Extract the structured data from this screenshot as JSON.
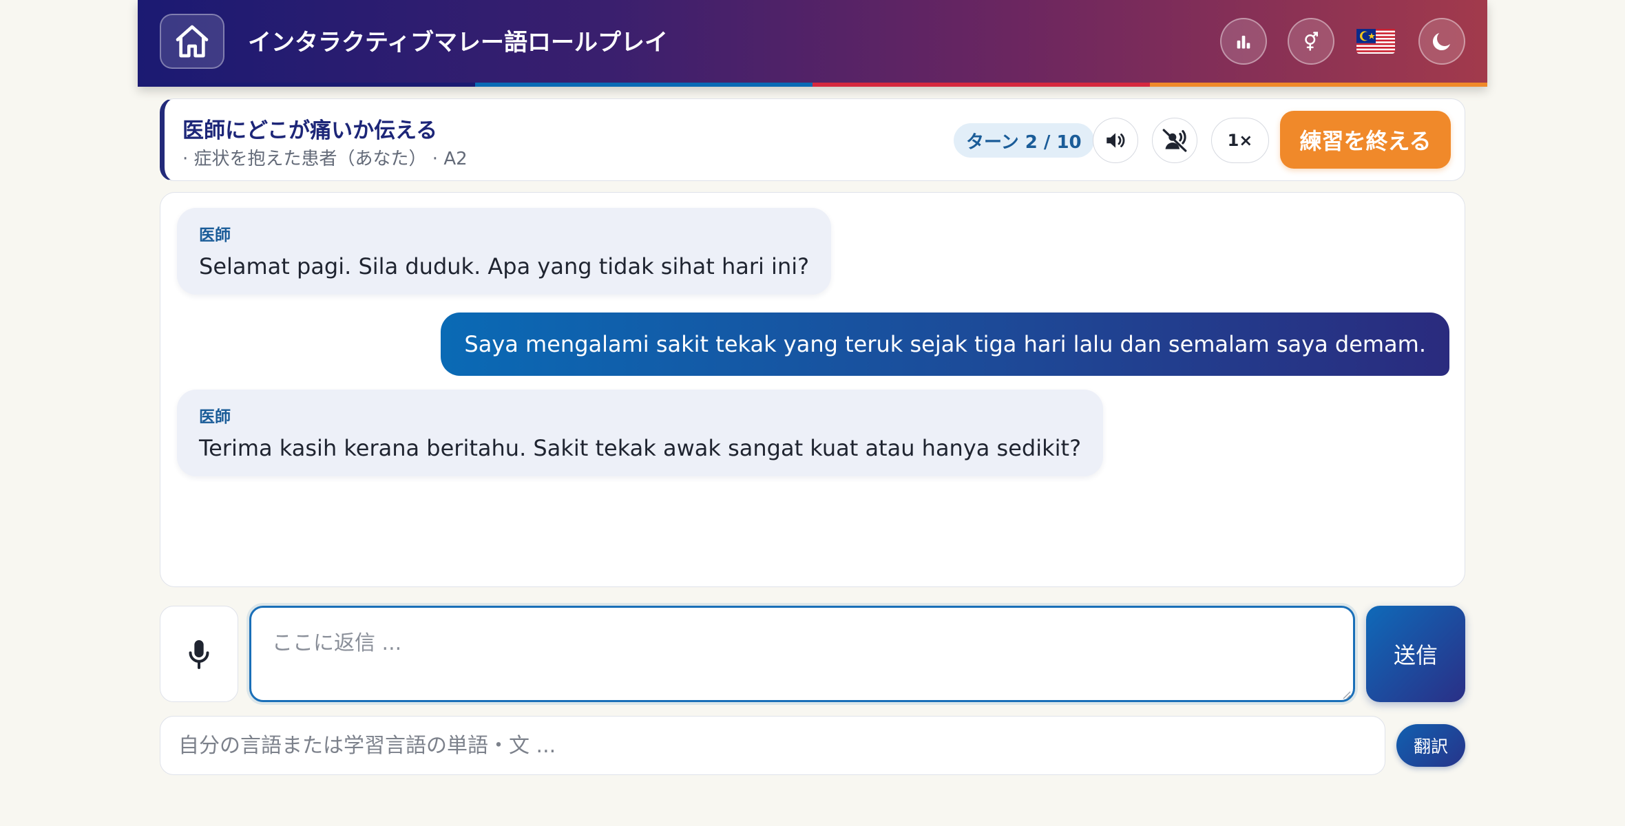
{
  "header": {
    "title": "インタラクティブマレー語ロールプレイ",
    "home_icon": "home-icon",
    "stats_icon": "bar-chart-icon",
    "gender_icon": "gender-icon",
    "flag_icon": "malaysia-flag-icon",
    "theme_icon": "moon-icon",
    "stripe_colors": [
      "#1b1a72",
      "#0a6ab5",
      "#d6283f",
      "#f0892a"
    ]
  },
  "scenario": {
    "title": "医師にどこが痛いか伝える",
    "subtitle": "· 症状を抱えた患者（あなた） · A2",
    "turn_label": "ターン 2 / 10",
    "speed_label": "1×",
    "end_button": "練習を終える",
    "accent_color": "#f0892a"
  },
  "chat": {
    "messages": [
      {
        "role": "partner",
        "speaker": "医師",
        "text": "Selamat pagi. Sila duduk. Apa yang tidak sihat hari ini?"
      },
      {
        "role": "user",
        "text": "Saya mengalami sakit tekak yang teruk sejak tiga hari lalu dan semalam saya demam."
      },
      {
        "role": "partner",
        "speaker": "医師",
        "text": "Terima kasih kerana beritahu. Sakit tekak awak sangat kuat atau hanya sedikit?"
      }
    ]
  },
  "composer": {
    "mic_icon": "microphone-icon",
    "placeholder": "ここに返信 ...",
    "value": "",
    "send_label": "送信"
  },
  "translator": {
    "placeholder": "自分の言語または学習言語の単語・文 ...",
    "value": "",
    "button_label": "翻訳"
  }
}
